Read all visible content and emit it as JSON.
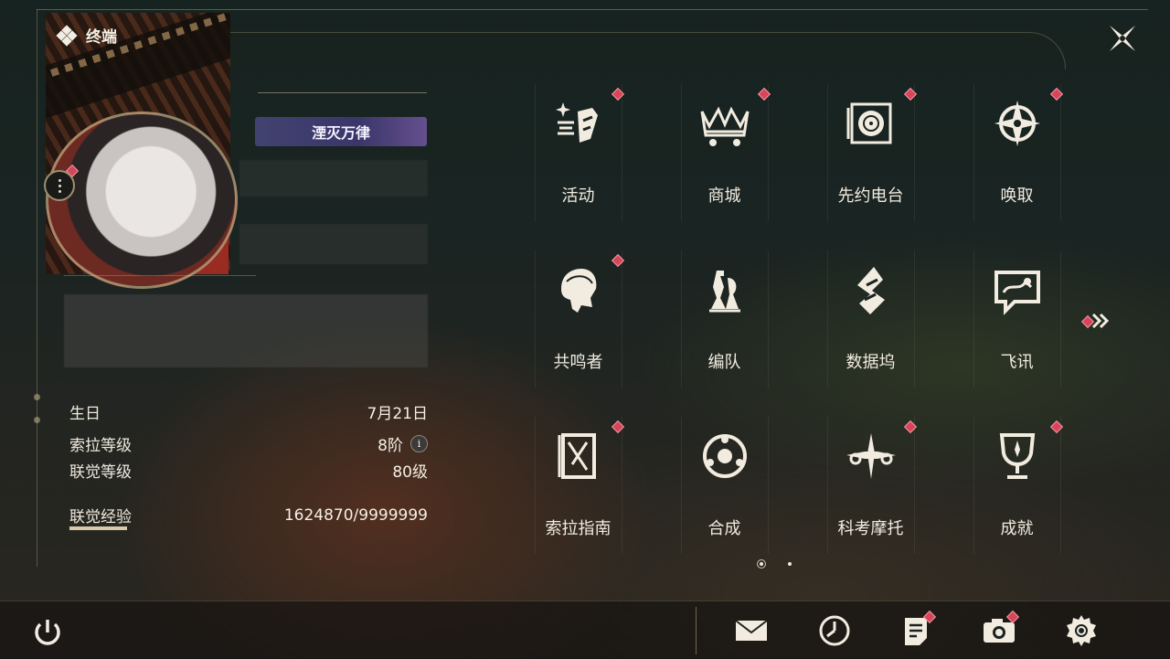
{
  "header": {
    "title": "终端",
    "title_icon": "diamond-cluster-icon",
    "close_icon": "close-x-icon"
  },
  "profile": {
    "badge_title": "湮灭万律",
    "more_icon": "more-vertical-icon"
  },
  "stats": [
    {
      "key": "生日",
      "value": "7月21日"
    },
    {
      "key": "索拉等级",
      "value": "8阶",
      "has_info": true
    },
    {
      "key": "联觉等级",
      "value": "80级"
    },
    {
      "key": "联觉经验",
      "value": "1624870/9999999",
      "progress": 0.1625
    }
  ],
  "menu": {
    "tiles": [
      {
        "label": "活动",
        "icon": "sparkle-flag-icon",
        "badge": true
      },
      {
        "label": "商城",
        "icon": "crown-cart-icon",
        "badge": true
      },
      {
        "label": "先约电台",
        "icon": "radio-record-icon",
        "badge": true
      },
      {
        "label": "唤取",
        "icon": "compass-star-icon",
        "badge": true
      },
      {
        "label": "共鸣者",
        "icon": "character-head-icon",
        "badge": true
      },
      {
        "label": "编队",
        "icon": "chess-pieces-icon",
        "badge": false
      },
      {
        "label": "数据坞",
        "icon": "data-dock-icon",
        "badge": false
      },
      {
        "label": "飞讯",
        "icon": "chat-message-icon",
        "badge": false
      },
      {
        "label": "索拉指南",
        "icon": "guide-book-icon",
        "badge": true
      },
      {
        "label": "合成",
        "icon": "synthesis-circle-icon",
        "badge": false
      },
      {
        "label": "科考摩托",
        "icon": "motorcycle-icon",
        "badge": true
      },
      {
        "label": "成就",
        "icon": "trophy-icon",
        "badge": true
      }
    ],
    "next_page_icon": "double-chevron-right-icon",
    "page_index": 1,
    "page_count": 2
  },
  "bottom_bar": {
    "power_icon": "power-icon",
    "buttons": [
      {
        "icon": "mail-icon",
        "badge": false
      },
      {
        "icon": "clock-icon",
        "badge": false
      },
      {
        "icon": "notice-icon",
        "badge": true
      },
      {
        "icon": "camera-icon",
        "badge": true
      },
      {
        "icon": "settings-gear-icon",
        "badge": false
      }
    ]
  },
  "colors": {
    "accent_gold": "#d6c496",
    "badge_red": "#d8455a",
    "text": "#f2ece0"
  }
}
